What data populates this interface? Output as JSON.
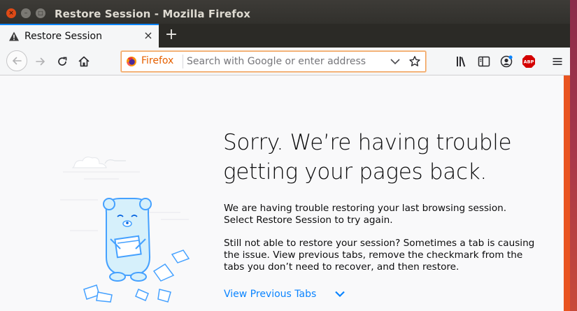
{
  "window": {
    "title": "Restore Session - Mozilla Firefox",
    "controls": {
      "close": "×",
      "minimize": "–",
      "maximize": "□"
    }
  },
  "tabs": [
    {
      "title": "Restore Session",
      "icon": "warning-icon",
      "close": "×",
      "active": true
    }
  ],
  "tabstrip": {
    "new_tab": "+"
  },
  "navbar": {
    "identity_icon": "firefox-logo-icon",
    "brand_label": "Firefox",
    "url_placeholder": "Search with Google or enter address",
    "url_value": "",
    "toolbar_icons": [
      "library-icon",
      "sidebar-icon",
      "account-icon",
      "adblock-plus-icon",
      "menu-icon"
    ],
    "adblock_badge": "ABP"
  },
  "page": {
    "headline_line1": "Sorry. We’re having trouble",
    "headline_line2": "getting your pages back.",
    "para1_line1": "We are having trouble restoring your last browsing session.",
    "para1_line2": "Select Restore Session to try again.",
    "para2_line1": "Still not able to restore your session? Sometimes a tab is causing",
    "para2_line2": "the issue. View previous tabs, remove the checkmark from the",
    "para2_line3": "tabs you don’t need to recover, and then restore.",
    "view_previous_tabs": "View Previous Tabs"
  },
  "colors": {
    "accent": "#0a84ff",
    "urlbar_focus": "#f0a05a",
    "scrollbar": "#e95420",
    "titlebar": "#3d3b37"
  }
}
